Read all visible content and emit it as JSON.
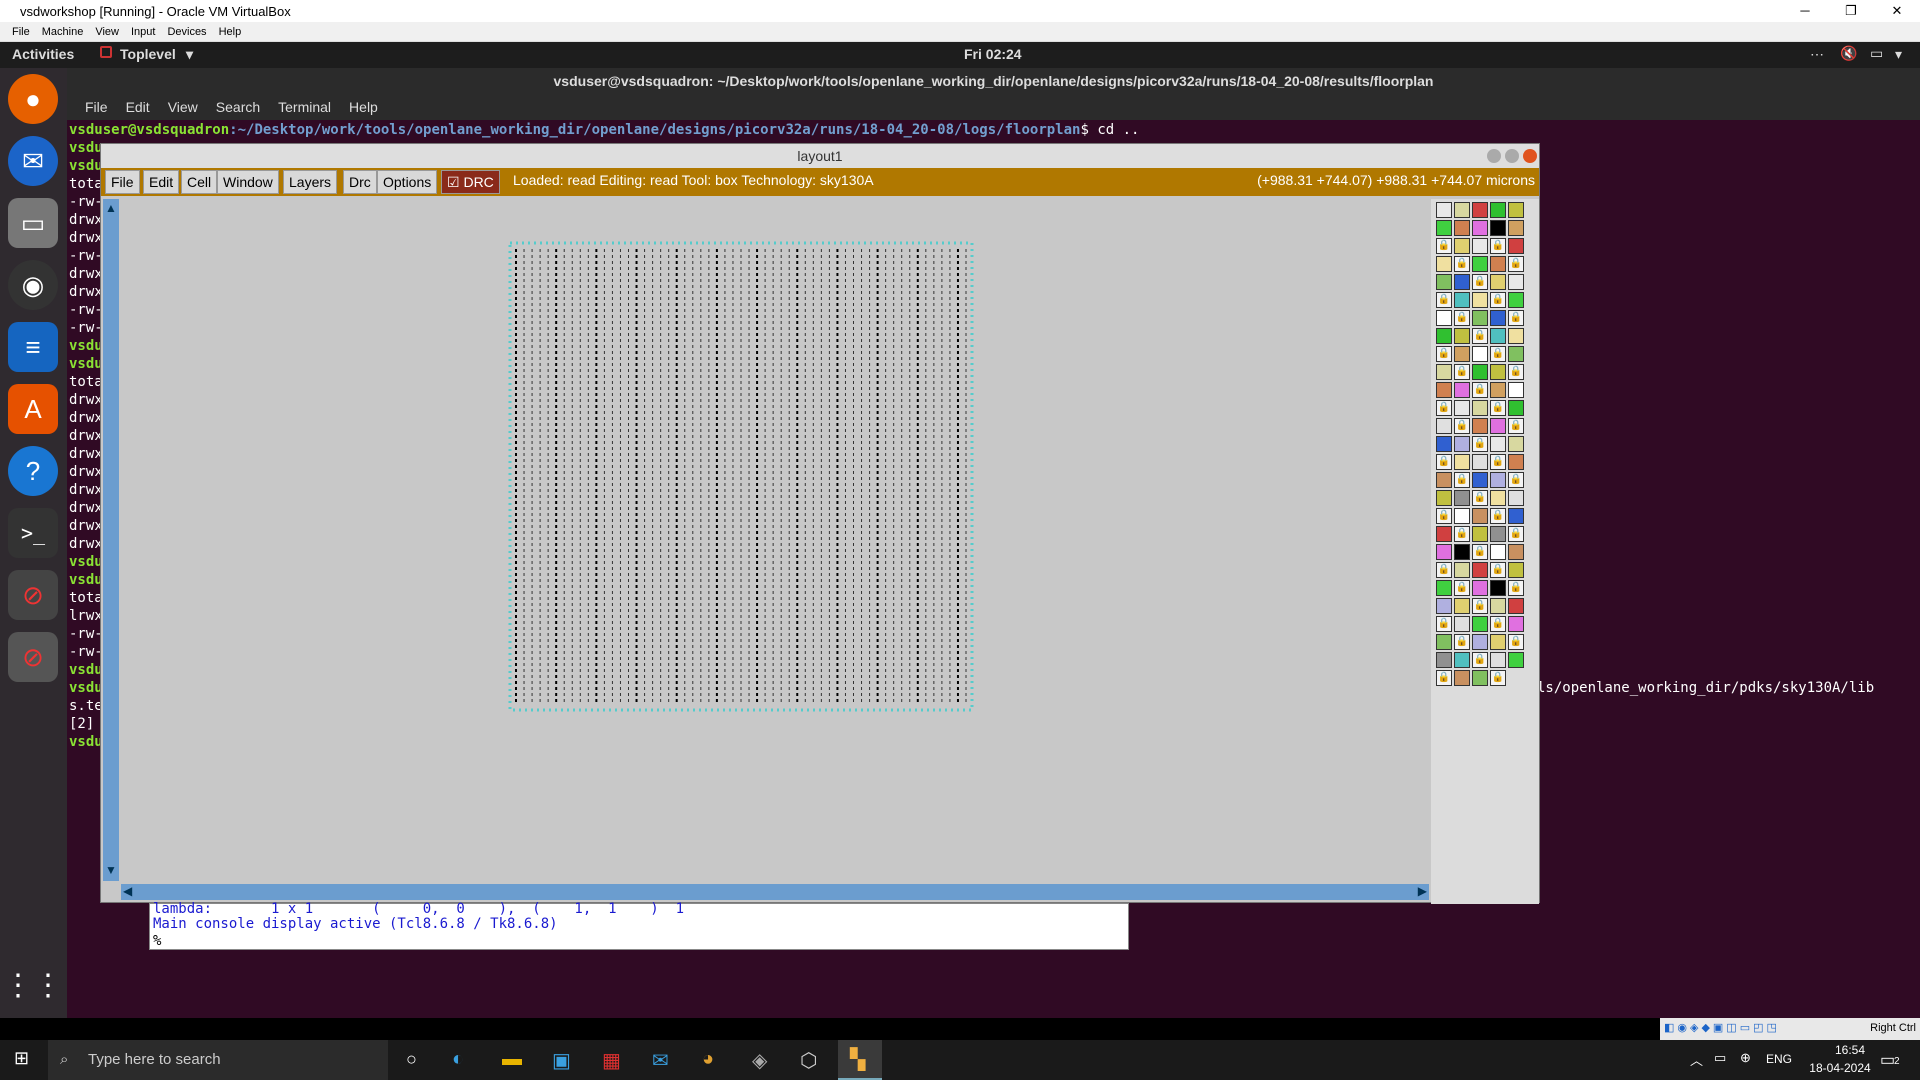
{
  "vbox": {
    "title": "vsdworkshop [Running] - Oracle VM VirtualBox",
    "menu": [
      "File",
      "Machine",
      "View",
      "Input",
      "Devices",
      "Help"
    ],
    "minimize": "─",
    "maximize": "❐",
    "close": "✕"
  },
  "ubuntu": {
    "activities": "Activities",
    "app_menu": "Toplevel",
    "clock": "Fri 02:24"
  },
  "terminal": {
    "title": "vsduser@vsdsquadron: ~/Desktop/work/tools/openlane_working_dir/openlane/designs/picorv32a/runs/18-04_20-08/results/floorplan",
    "menu": [
      "File",
      "Edit",
      "View",
      "Search",
      "Terminal",
      "Help"
    ],
    "prompt_user": "vsduser@vsdsquadron",
    "prompt_path": ":~/Desktop/work/tools/openlane_working_dir/openlane/designs/picorv32a/runs/18-04_20-08/logs/floorplan",
    "prompt_cmd": "$ cd ..",
    "lines": [
      "vsdu",
      "vsdu",
      "tota",
      "-rw-",
      "drwx",
      "drwx",
      "-rw-",
      "drwx",
      "drwx",
      "-rw-",
      "-rw-",
      "vsdu",
      "vsdu",
      "tota",
      "drwx",
      "drwx",
      "drwx",
      "drwx",
      "drwx",
      "drwx",
      "drwx",
      "drwx",
      "drwx",
      "vsdu",
      "vsdu",
      "tota",
      "lrwx",
      "-rw-",
      "-rw-",
      "vsdu",
      "vsdu",
      "s.te",
      "[2]",
      "vsdu"
    ],
    "right_text": "ls/openlane_working_dir/pdks/sky130A/lib"
  },
  "magic": {
    "title": "layout1",
    "menus": [
      "File",
      "Edit",
      "Cell",
      "Window",
      "Layers",
      "Drc",
      "Options"
    ],
    "drc_label": "DRC",
    "status": "Loaded: read  Editing: read  Tool: box   Technology: sky130A",
    "coords": "(+988.31 +744.07) +988.31 +744.07 microns"
  },
  "console": {
    "line1": "lambda:       1 x 1       (     0,  0    ),  (    1,  1    )  1",
    "line2": "Main console display active (Tcl8.6.8 / Tk8.6.8)",
    "prompt": "%"
  },
  "vb_status": {
    "host_key": "Right Ctrl"
  },
  "taskbar": {
    "search_placeholder": "Type here to search",
    "lang": "ENG",
    "time": "16:54",
    "date": "18-04-2024",
    "notif": "2"
  }
}
